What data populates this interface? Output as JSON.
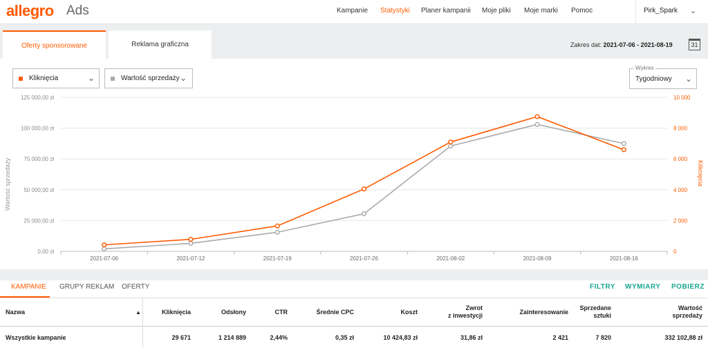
{
  "header": {
    "logo": "allegro",
    "logo_sub": "Ads",
    "nav": [
      "Kampanie",
      "Statystyki",
      "Planer kampanii",
      "Moje pliki",
      "Moje marki",
      "Pomoc"
    ],
    "active_nav": "Statystyki",
    "user": "Pirk_Spark"
  },
  "tabs": [
    "Oferty sponsorowane",
    "Reklama graficzna"
  ],
  "date_range": {
    "label": "Zakres dat:",
    "value": "2021-07-06 - 2021-08-19",
    "calendar_day": "31"
  },
  "metric_left": {
    "label": "Kliknięcia",
    "color": "#ff5a00"
  },
  "metric_right": {
    "label": "Wartość sprzedaży",
    "color": "#aaaaaa"
  },
  "chart_type": {
    "legend": "Wykres",
    "value": "Tygodniowy"
  },
  "chart_data": {
    "type": "line",
    "x": [
      "2021-07-06",
      "2021-07-12",
      "2021-07-19",
      "2021-07-26",
      "2021-08-02",
      "2021-08-09",
      "2021-08-16"
    ],
    "y_left_label": "Wartość sprzedaży",
    "y_right_label": "Kliknięcia",
    "y_left_ticks": [
      "0,00 zł",
      "25 000,00 zł",
      "50 000,00 zł",
      "75 000,00 zł",
      "100 000,00 zł",
      "125 000,00 zł"
    ],
    "y_right_ticks": [
      "0",
      "2 000",
      "4 000",
      "6 000",
      "8 000",
      "10 000"
    ],
    "ylim_left": [
      0,
      125000
    ],
    "ylim_right": [
      0,
      10000
    ],
    "grid": true,
    "series": [
      {
        "name": "Kliknięcia",
        "axis": "right",
        "color": "#ff5a00",
        "values": [
          420,
          780,
          1650,
          4050,
          7100,
          8750,
          6600
        ]
      },
      {
        "name": "Wartość sprzedaży",
        "axis": "left",
        "color": "#aaaaaa",
        "values": [
          2000,
          6500,
          15500,
          30500,
          85500,
          103000,
          87500
        ]
      }
    ]
  },
  "bottom_tabs": [
    "KAMPANIE",
    "GRUPY REKLAM",
    "OFERTY"
  ],
  "actions": [
    "FILTRY",
    "WYMIARY",
    "POBIERZ"
  ],
  "table": {
    "headers": [
      {
        "l1": "Nazwa",
        "l2": ""
      },
      {
        "l1": "Kliknięcia",
        "l2": ""
      },
      {
        "l1": "Odsłony",
        "l2": ""
      },
      {
        "l1": "CTR",
        "l2": ""
      },
      {
        "l1": "Średnie CPC",
        "l2": ""
      },
      {
        "l1": "Koszt",
        "l2": ""
      },
      {
        "l1": "Zwrot",
        "l2": "z inwestycji"
      },
      {
        "l1": "Zainteresowanie",
        "l2": ""
      },
      {
        "l1": "Sprzedane",
        "l2": "sztuki"
      },
      {
        "l1": "Wartość",
        "l2": "sprzedaży"
      }
    ],
    "row": [
      "Wszystkie kampanie",
      "29 671",
      "1 214 889",
      "2,44%",
      "0,35 zł",
      "10 424,83 zł",
      "31,86 zł",
      "2 421",
      "7 820",
      "332 102,88 zł"
    ]
  }
}
